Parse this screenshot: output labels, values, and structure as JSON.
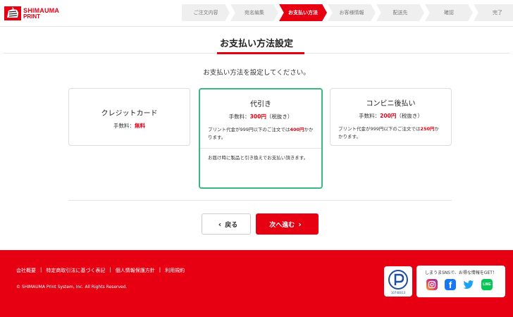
{
  "header": {
    "logo_line1": "SHIMAUMA",
    "logo_line2": "PRINT",
    "steps": [
      {
        "label": "ご注文内容",
        "active": false
      },
      {
        "label": "宛名編集",
        "active": false
      },
      {
        "label": "お支払い方法",
        "active": true
      },
      {
        "label": "お客様情報",
        "active": false
      },
      {
        "label": "配送先",
        "active": false
      },
      {
        "label": "確認",
        "active": false
      },
      {
        "label": "完了",
        "active": false
      }
    ]
  },
  "main": {
    "title": "お支払い方法設定",
    "instruction": "お支払い方法を設定してください。",
    "methods": {
      "credit": {
        "name": "クレジットカード",
        "fee_label": "手数料：",
        "fee_value": "無料"
      },
      "cod": {
        "name": "代引き",
        "fee_label": "手数料：",
        "fee_value": "300円",
        "fee_suffix": "（税抜き）",
        "note_pre": "プリント代金が999円以下のご注文では",
        "note_red": "400円",
        "note_post": "かかります。",
        "extra": "お届け時に製品と引き換えでお支払い頂きます。"
      },
      "conbini": {
        "name": "コンビニ後払い",
        "fee_label": "手数料：",
        "fee_value": "200円",
        "fee_suffix": "（税抜き）",
        "note_pre": "プリント代金が999円以下のご注文では",
        "note_red": "250円",
        "note_post": "かかります。"
      }
    },
    "back_label": "戻る",
    "next_label": "次へ進む"
  },
  "footer": {
    "links": [
      "会社概要",
      "特定商取引法に基づく表記",
      "個人情報保護方針",
      "利用規約"
    ],
    "copyright": "© SHIMAUMA Print System, Inc. All Rights Reserved.",
    "privacy_mark_number": "10740013",
    "sns_title": "しまうまSNSで、お得な情報をGET！",
    "sns": [
      {
        "name": "instagram",
        "color": "#c13584"
      },
      {
        "name": "facebook",
        "color": "#1877f2"
      },
      {
        "name": "twitter",
        "color": "#1da1f2"
      },
      {
        "name": "line",
        "color": "#06c755",
        "label": "LINE"
      }
    ]
  },
  "colors": {
    "accent": "#e60012",
    "selected": "#3bb87f"
  }
}
